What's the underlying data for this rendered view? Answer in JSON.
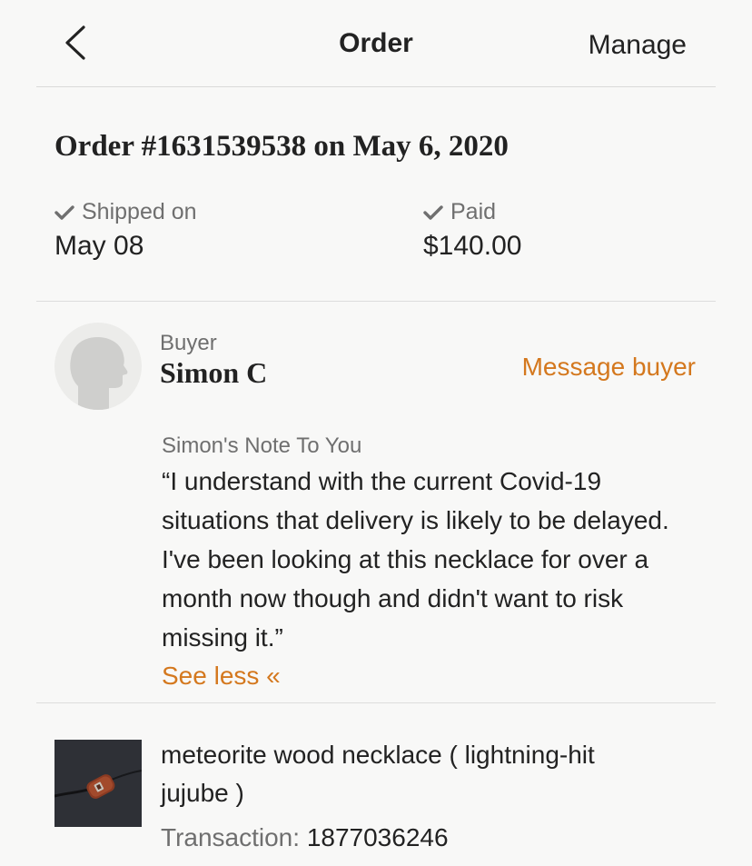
{
  "header": {
    "title": "Order",
    "manage_label": "Manage"
  },
  "order": {
    "heading": "Order #1631539538 on May 6, 2020",
    "shipped_label": "Shipped on",
    "shipped_date": "May 08",
    "paid_label": "Paid",
    "paid_amount": "$140.00"
  },
  "buyer": {
    "label": "Buyer",
    "name": "Simon C",
    "message_label": "Message buyer"
  },
  "note": {
    "title": "Simon's Note To You",
    "text": "“I understand with the current Covid-19 situations that delivery is likely to be delayed. I've been looking at this necklace for over a month now though and didn't want to risk missing it.”",
    "toggle_label": "See less «"
  },
  "item": {
    "title": "meteorite wood necklace ( lightning-hit jujube )",
    "transaction_label": "Transaction:",
    "transaction_number": "1877036246"
  },
  "colors": {
    "accent": "#d4781e",
    "muted_text": "#6f6f6f",
    "primary_text": "#222222",
    "background": "#f8f8f7",
    "divider": "#dddddd"
  },
  "icons": {
    "back": "chevron-left-icon",
    "shipped": "check-icon",
    "paid": "check-icon",
    "avatar": "person-silhouette-icon"
  }
}
